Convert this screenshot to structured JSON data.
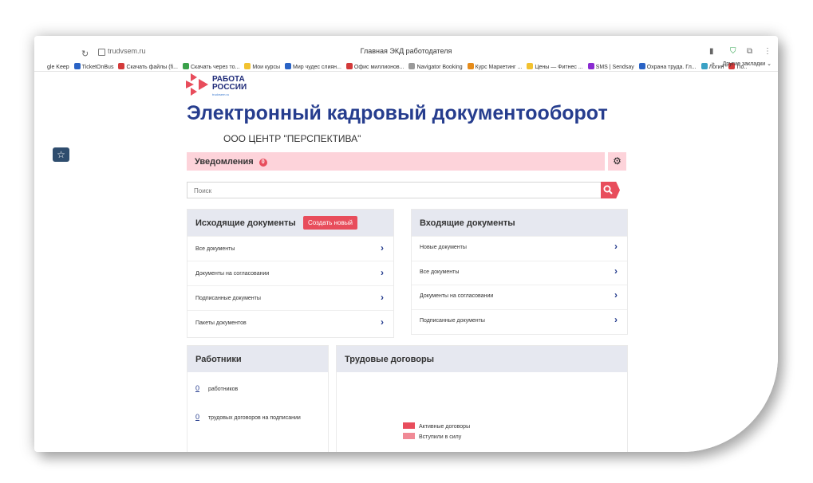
{
  "browser": {
    "url": "trudvsem.ru",
    "window_title": "Главная ЭКД работодателя",
    "bookmarks": [
      {
        "label": "gle Keep",
        "color": "#ffffff"
      },
      {
        "label": "TicketOnBus",
        "color": "#2a63c5"
      },
      {
        "label": "Скачать файлы (fi...",
        "color": "#d33a3a"
      },
      {
        "label": "Скачать через то...",
        "color": "#3aa14a"
      },
      {
        "label": "Мои курсы",
        "color": "#f2c230"
      },
      {
        "label": "Мир чудес слиян...",
        "color": "#2a63c5"
      },
      {
        "label": "Офис миллионов...",
        "color": "#d33a3a"
      },
      {
        "label": "Navigator Booking",
        "color": "#9a9a9a"
      },
      {
        "label": "Курс Маркетинг ...",
        "color": "#e58b1a"
      },
      {
        "label": "Цены — Фитнес ...",
        "color": "#f2c230"
      },
      {
        "label": "SMS | Sendsay",
        "color": "#8a2bd1"
      },
      {
        "label": "Охрана труда. Гл...",
        "color": "#2a63c5"
      },
      {
        "label": "Логин",
        "color": "#3aa1c5"
      },
      {
        "label": "По..",
        "color": "#d33a3a"
      }
    ],
    "bookmarks_more": "»",
    "other_bookmarks": "Другие закладки"
  },
  "site": {
    "logo_line1": "РАБОТА",
    "logo_line2": "РОССИИ",
    "logo_sub": "trudvsem.ru",
    "page_title": "Электронный кадровый документооборот",
    "company": "ООО ЦЕНТР \"ПЕРСПЕКТИВА\"",
    "notifications_label": "Уведомления",
    "notifications_count": "0",
    "search_placeholder": "Поиск"
  },
  "outgoing": {
    "title": "Исходящие документы",
    "new_button": "Создать новый",
    "items": [
      "Все документы",
      "Документы на согласовании",
      "Подписанные документы",
      "Пакеты документов"
    ]
  },
  "incoming": {
    "title": "Входящие документы",
    "items": [
      "Новые документы",
      "Все документы",
      "Документы на согласовании",
      "Подписанные документы"
    ]
  },
  "workers": {
    "title": "Работники",
    "rows": [
      {
        "count": "0",
        "label": "работников"
      },
      {
        "count": "0",
        "label": "трудовых договоров на подписании"
      }
    ]
  },
  "contracts": {
    "title": "Трудовые договоры",
    "legend": [
      {
        "label": "Активные договоры",
        "color": "#e84d5c"
      },
      {
        "label": "Вступили в силу",
        "color": "#f08a96"
      }
    ]
  },
  "colors": {
    "accent": "#e84d5c",
    "brand_blue": "#263d8e",
    "notif_bg": "#fdd3da",
    "panel_head": "#e6e8f0"
  }
}
